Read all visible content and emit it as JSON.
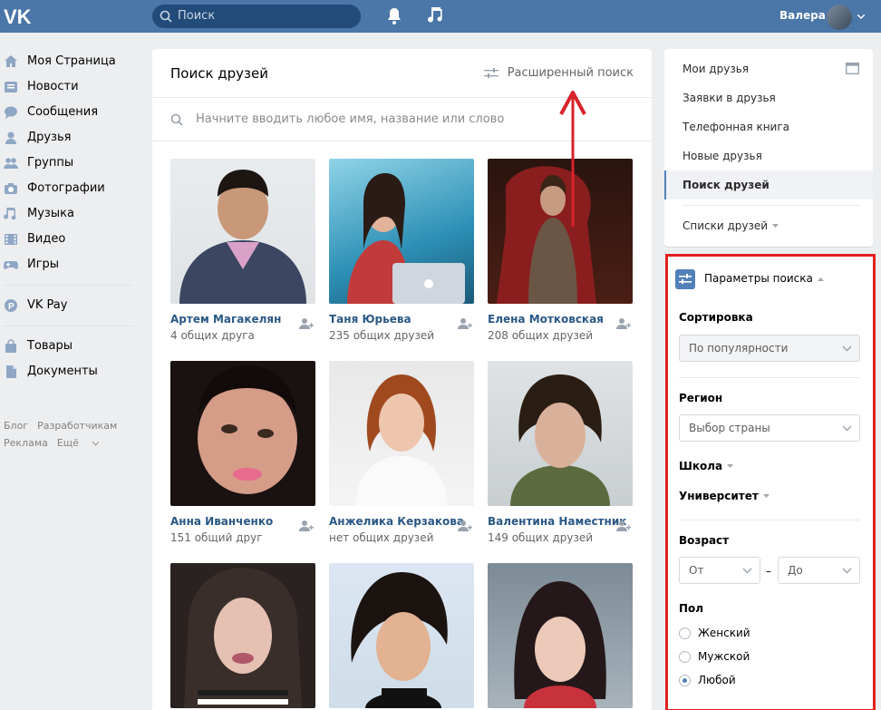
{
  "header": {
    "search_placeholder": "Поиск",
    "user_name": "Валера"
  },
  "leftnav": {
    "items": [
      {
        "label": "Моя Страница",
        "icon": "home-icon"
      },
      {
        "label": "Новости",
        "icon": "news-icon"
      },
      {
        "label": "Сообщения",
        "icon": "messages-icon"
      },
      {
        "label": "Друзья",
        "icon": "friends-icon"
      },
      {
        "label": "Группы",
        "icon": "groups-icon"
      },
      {
        "label": "Фотографии",
        "icon": "photos-icon"
      },
      {
        "label": "Музыка",
        "icon": "music-icon"
      },
      {
        "label": "Видео",
        "icon": "video-icon"
      },
      {
        "label": "Игры",
        "icon": "games-icon"
      }
    ],
    "vkpay": "VK Pay",
    "extra": [
      {
        "label": "Товары",
        "icon": "market-icon"
      },
      {
        "label": "Документы",
        "icon": "documents-icon"
      }
    ],
    "footer": [
      "Блог",
      "Разработчикам",
      "Реклама",
      "Ещё"
    ]
  },
  "main": {
    "title": "Поиск друзей",
    "advanced_search": "Расширенный поиск",
    "search_placeholder": "Начните вводить любое имя, название или слово",
    "people": [
      {
        "name": "Артем Магакелян",
        "mutual": "4 общих друга"
      },
      {
        "name": "Таня Юрьева",
        "mutual": "235 общих друзей"
      },
      {
        "name": "Елена Мотковская",
        "mutual": "208 общих друзей"
      },
      {
        "name": "Анна Иванченко",
        "mutual": "151 общий друг"
      },
      {
        "name": "Анжелика Керзакова",
        "mutual": "нет общих друзей"
      },
      {
        "name": "Валентина Наместник",
        "mutual": "149 общих друзей"
      },
      {
        "name": "",
        "mutual": ""
      },
      {
        "name": "",
        "mutual": ""
      },
      {
        "name": "",
        "mutual": ""
      }
    ]
  },
  "rightmenu": {
    "items": [
      "Мои друзья",
      "Заявки в друзья",
      "Телефонная книга",
      "Новые друзья",
      "Поиск друзей"
    ],
    "lists": "Списки друзей"
  },
  "params": {
    "title": "Параметры поиска",
    "sort_label": "Сортировка",
    "sort_value": "По популярности",
    "region_label": "Регион",
    "region_value": "Выбор страны",
    "school_label": "Школа",
    "university_label": "Университет",
    "age_label": "Возраст",
    "age_from": "От",
    "age_to": "До",
    "age_dash": "–",
    "gender_label": "Пол",
    "gender_options": [
      "Женский",
      "Мужской",
      "Любой"
    ],
    "gender_selected": "Любой"
  },
  "colors": {
    "header_bg": "#4a76a8",
    "link": "#2a5885",
    "accent": "#5181b8",
    "highlight_border": "#e1211d"
  }
}
